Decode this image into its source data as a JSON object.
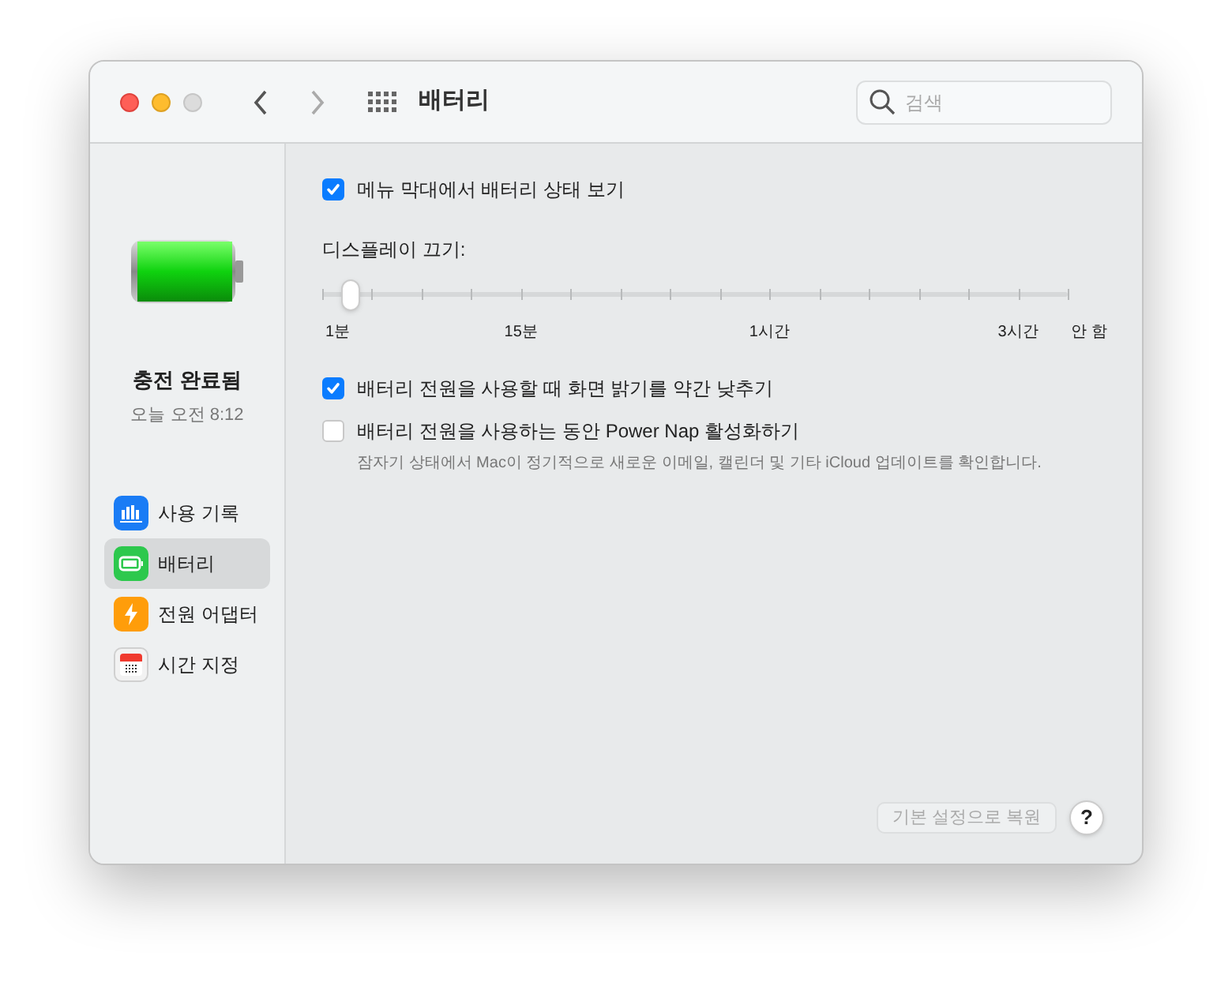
{
  "window": {
    "title": "배터리"
  },
  "search": {
    "placeholder": "검색"
  },
  "status": {
    "title": "충전 완료됨",
    "time": "오늘 오전 8:12"
  },
  "sidebar": {
    "items": [
      {
        "label": "사용 기록",
        "kind": "chart",
        "selected": false
      },
      {
        "label": "배터리",
        "kind": "battery",
        "selected": true
      },
      {
        "label": "전원 어댑터",
        "kind": "power",
        "selected": false
      },
      {
        "label": "시간 지정",
        "kind": "calendar",
        "selected": false
      }
    ]
  },
  "menu_bar_option": {
    "label": "메뉴 막대에서 배터리 상태 보기",
    "checked": true
  },
  "display_off": {
    "label": "디스플레이 끄기:",
    "level": 0.038,
    "tick_labels": [
      "1분",
      "15분",
      "1시간",
      "3시간",
      "안 함"
    ]
  },
  "options": [
    {
      "label": "배터리 전원을 사용할 때 화면 밝기를 약간 낮추기",
      "checked": true
    },
    {
      "label": "배터리 전원을 사용하는 동안 Power Nap 활성화하기",
      "checked": false,
      "description": "잠자기 상태에서 Mac이 정기적으로 새로운 이메일, 캘린더 및 기타 iCloud 업데이트를 확인합니다."
    }
  ],
  "buttons": {
    "restore": "기본 설정으로 복원",
    "help": "?"
  }
}
